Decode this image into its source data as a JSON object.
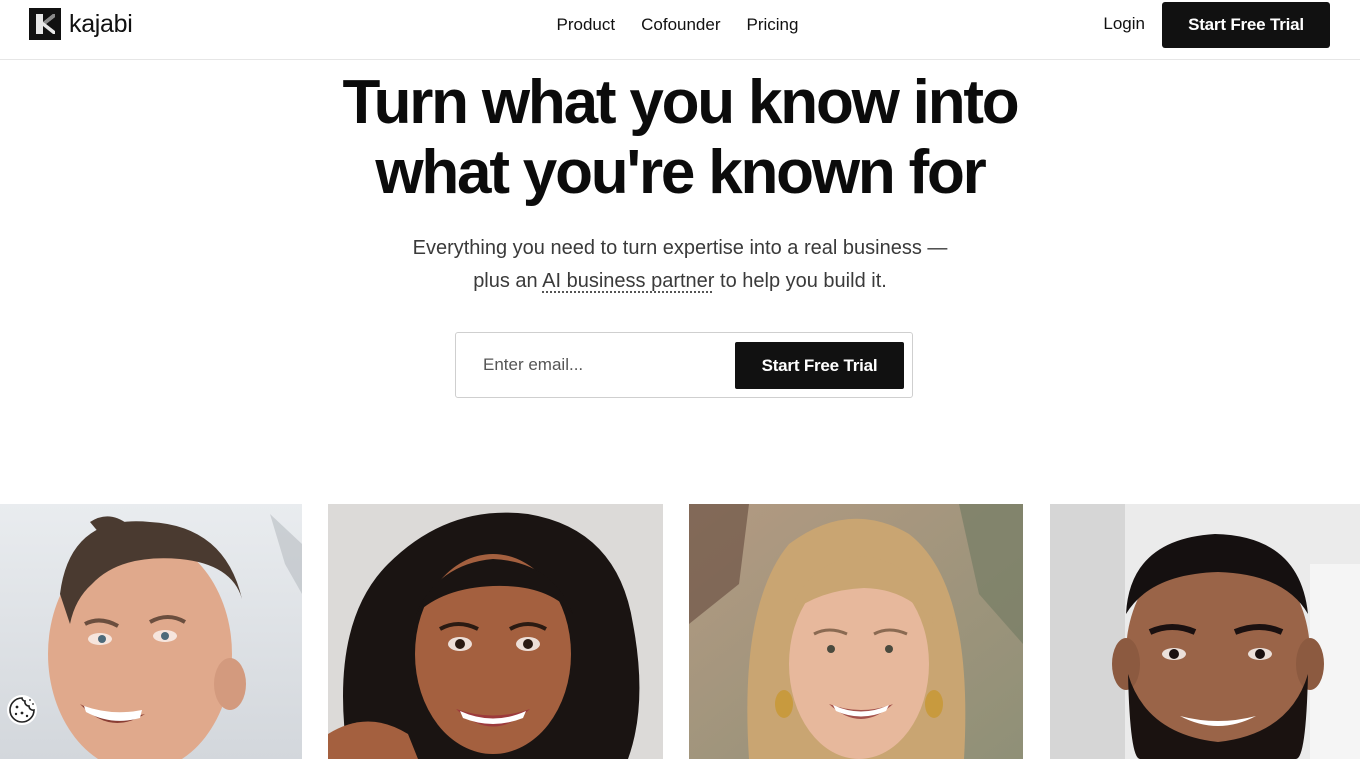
{
  "brand": {
    "name": "kajabi"
  },
  "nav": {
    "items": [
      {
        "label": "Product"
      },
      {
        "label": "Cofounder"
      },
      {
        "label": "Pricing"
      }
    ],
    "login_label": "Login",
    "cta_label": "Start Free Trial"
  },
  "hero": {
    "headline_line1": "Turn what you know into",
    "headline_line2": "what you're known for",
    "sub_line1": "Everything you need to turn expertise into a real business —",
    "sub_line2_before": "plus an ",
    "sub_line2_link": "AI business partner",
    "sub_line2_after": " to help you build it.",
    "email_placeholder": "Enter email...",
    "email_value": "",
    "cta_label": "Start Free Trial"
  },
  "gallery": {
    "photos": [
      {
        "icon": "person-photo-man-smiling"
      },
      {
        "icon": "person-photo-woman-curly-hair"
      },
      {
        "icon": "person-photo-woman-blonde"
      },
      {
        "icon": "person-photo-man-beard"
      }
    ]
  },
  "cookie": {
    "icon": "cookie-icon"
  },
  "colors": {
    "primary": "#111111",
    "background": "#ffffff",
    "text_muted": "#3a3a3a",
    "border": "#cfcfcf"
  }
}
